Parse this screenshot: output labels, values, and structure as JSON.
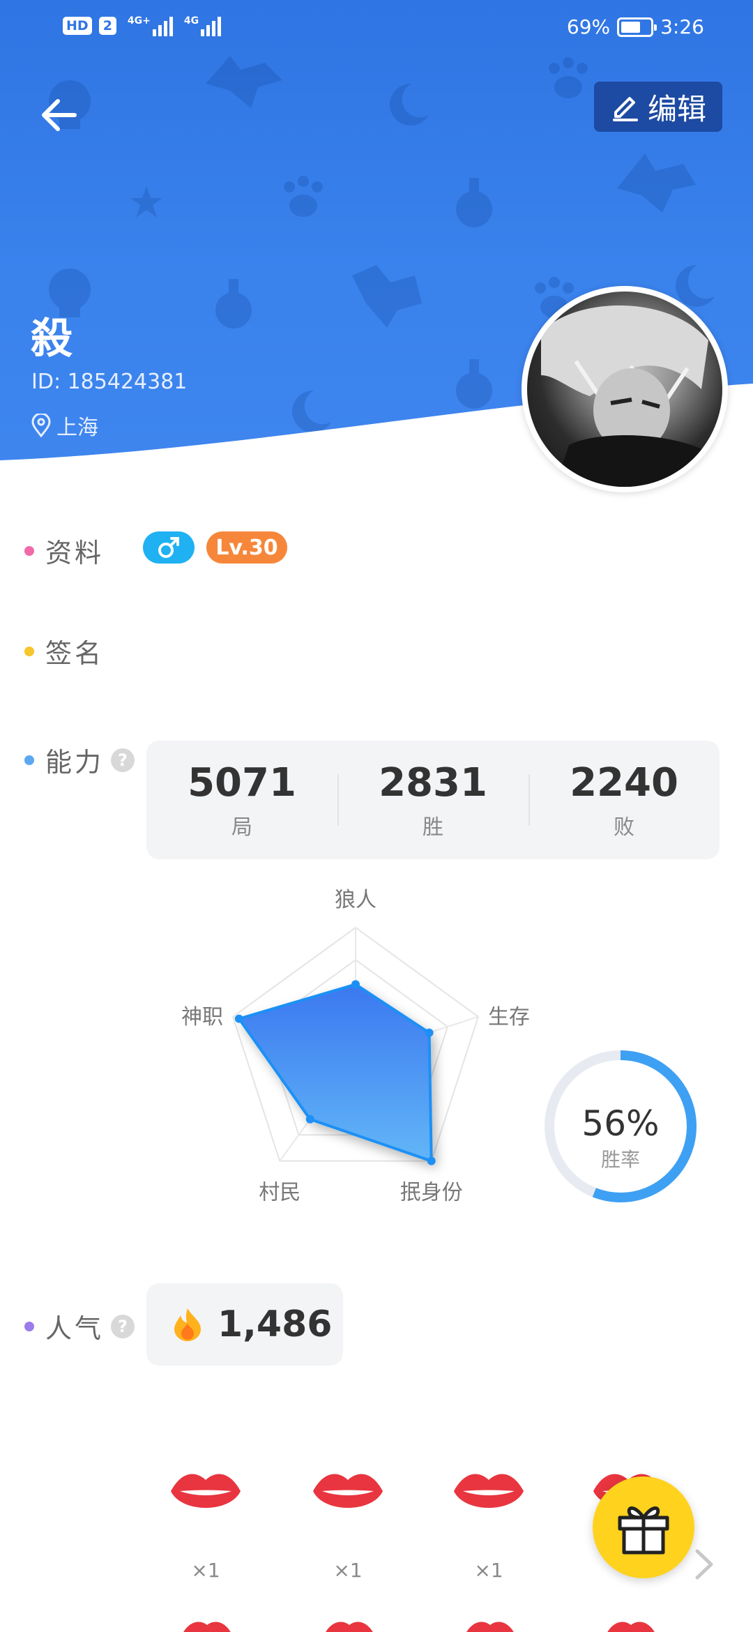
{
  "status_bar": {
    "hd": "HD",
    "sim": "2",
    "net1": "4G+",
    "net2": "4G",
    "battery": "69%",
    "time": "3:26"
  },
  "header": {
    "edit_label": "编辑",
    "nickname": "殺",
    "user_id": "ID: 185424381",
    "location": "上海"
  },
  "profile": {
    "label": "资料",
    "gender_icon": "male-icon",
    "level": "Lv.30"
  },
  "signature": {
    "label": "签名"
  },
  "ability": {
    "label": "能力",
    "help": "?",
    "stats": [
      {
        "value": "5071",
        "label": "局"
      },
      {
        "value": "2831",
        "label": "胜"
      },
      {
        "value": "2240",
        "label": "败"
      }
    ],
    "radar": {
      "axes": [
        "狼人",
        "生存",
        "抿身份",
        "村民",
        "神职"
      ],
      "values": [
        0.56,
        0.6,
        1.0,
        0.6,
        0.95
      ]
    },
    "win_rate": {
      "value": "56%",
      "label": "胜率",
      "fraction": 0.56
    }
  },
  "popularity": {
    "label": "人气",
    "help": "?",
    "icon": "flame-icon",
    "value": "1,486"
  },
  "gifts": [
    {
      "icon": "lips-icon",
      "count": "×1"
    },
    {
      "icon": "lips-icon",
      "count": "×1"
    },
    {
      "icon": "lips-icon",
      "count": "×1"
    },
    {
      "icon": "lips-icon",
      "count": ""
    }
  ],
  "colors": {
    "header_blue": "#3a82ec",
    "edit_button": "#1d4aa2",
    "gender_badge": "#1fb1f2",
    "level_badge": "#f6873a",
    "dot_profile": "#f06aa8",
    "dot_signature": "#f7c52c",
    "dot_ability": "#5aa8f2",
    "dot_popularity": "#9b7ce8",
    "gift_button": "#ffd21e"
  }
}
